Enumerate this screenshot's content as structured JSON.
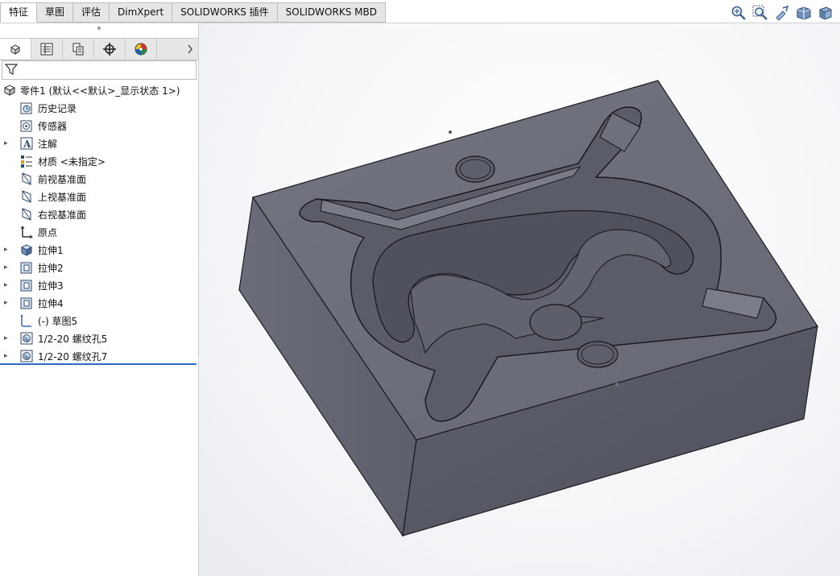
{
  "tabs": [
    {
      "label": "特征",
      "active": true
    },
    {
      "label": "草图",
      "active": false
    },
    {
      "label": "评估",
      "active": false
    },
    {
      "label": "DimXpert",
      "active": false
    },
    {
      "label": "SOLIDWORKS 插件",
      "active": false
    },
    {
      "label": "SOLIDWORKS MBD",
      "active": false
    }
  ],
  "view_tools": [
    "zoom-to-fit-icon",
    "zoom-area-icon",
    "previous-view-icon",
    "section-view-icon",
    "view-orientation-icon"
  ],
  "panel_tabs": [
    "feature-manager-icon",
    "property-manager-icon",
    "configuration-manager-icon",
    "dimxpert-manager-icon",
    "display-manager-icon"
  ],
  "tree": {
    "root": {
      "label": "零件1  (默认<<默认>_显示状态 1>)",
      "icon": "part-icon"
    },
    "items": [
      {
        "label": "历史记录",
        "icon": "history-icon",
        "expandable": false
      },
      {
        "label": "传感器",
        "icon": "sensor-icon",
        "expandable": false
      },
      {
        "label": "注解",
        "icon": "annotations-icon",
        "expandable": true
      },
      {
        "label": "材质 <未指定>",
        "icon": "material-icon",
        "expandable": false
      },
      {
        "label": "前视基准面",
        "icon": "plane-icon",
        "expandable": false
      },
      {
        "label": "上视基准面",
        "icon": "plane-icon",
        "expandable": false
      },
      {
        "label": "右视基准面",
        "icon": "plane-icon",
        "expandable": false
      },
      {
        "label": "原点",
        "icon": "origin-icon",
        "expandable": false
      },
      {
        "label": "拉伸1",
        "icon": "extrude-boss-icon",
        "expandable": true
      },
      {
        "label": "拉伸2",
        "icon": "extrude-cut-icon",
        "expandable": true
      },
      {
        "label": "拉伸3",
        "icon": "extrude-cut-icon",
        "expandable": true
      },
      {
        "label": "拉伸4",
        "icon": "extrude-cut-icon",
        "expandable": true
      },
      {
        "label": "(-) 草图5",
        "icon": "sketch-icon",
        "expandable": false
      },
      {
        "label": "1/2-20 螺纹孔5",
        "icon": "hole-wizard-icon",
        "expandable": true
      },
      {
        "label": "1/2-20 螺纹孔7",
        "icon": "hole-wizard-icon",
        "expandable": true
      }
    ]
  },
  "colors": {
    "model_top": "#6a6c7a",
    "model_front": "#595b68",
    "model_side": "#6e707e",
    "pocket_floor": "#4f515d",
    "edge": "#1b1c22",
    "accent": "#2a6bc7"
  }
}
